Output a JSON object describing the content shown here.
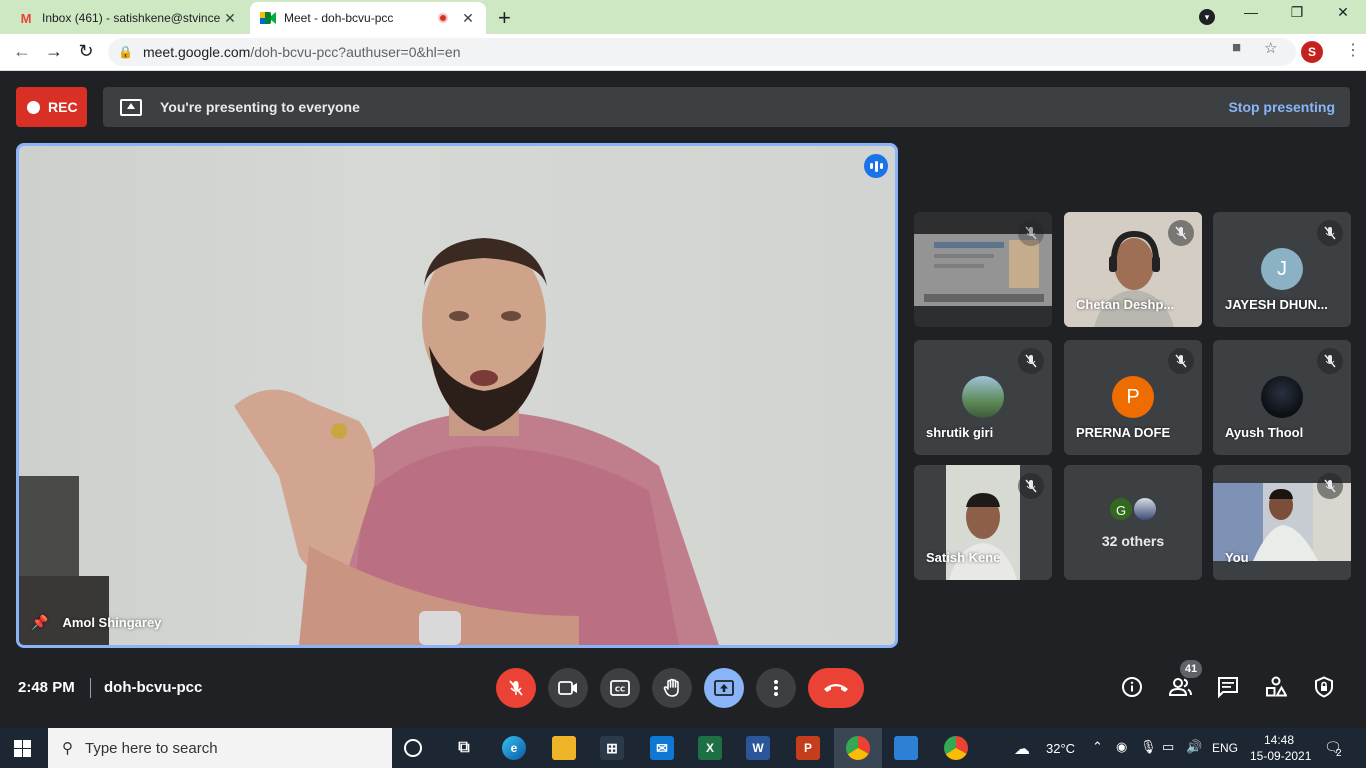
{
  "browser": {
    "tabs": [
      {
        "title": "Inbox (461) - satishkene@stvince",
        "favicon": "M",
        "active": false
      },
      {
        "title": "Meet - doh-bcvu-pcc",
        "favicon": "meet-icon",
        "active": true
      }
    ],
    "url_host": "meet.google.com",
    "url_path": "/doh-bcvu-pcc?authuser=0&hl=en",
    "profile_initial": "S"
  },
  "meet": {
    "rec_label": "REC",
    "presenting_text": "You're presenting to everyone",
    "stop_presenting": "Stop presenting",
    "main_speaker": "Amol Shingarey",
    "tiles": [
      {
        "name": "",
        "type": "screen"
      },
      {
        "name": "Chetan Deshp...",
        "type": "video"
      },
      {
        "name": "JAYESH DHUN...",
        "type": "avatar",
        "initial": "J",
        "color": "#8bb1c4"
      },
      {
        "name": "shrutik giri",
        "type": "photo"
      },
      {
        "name": "PRERNA DOFE",
        "type": "avatar",
        "initial": "P",
        "color": "#ef6c00"
      },
      {
        "name": "Ayush Thool",
        "type": "photo"
      },
      {
        "name": "Satish Kene",
        "type": "video"
      },
      {
        "name": "32 others",
        "type": "others",
        "initial": "G",
        "color": "#33691e"
      },
      {
        "name": "You",
        "type": "video"
      }
    ],
    "time": "2:48 PM",
    "meeting_code": "doh-bcvu-pcc",
    "participant_count": "41",
    "colors": {
      "accent": "#8ab4f8",
      "danger": "#ea4335",
      "surface": "#3c4043",
      "bg": "#202124"
    }
  },
  "taskbar": {
    "search_placeholder": "Type here to search",
    "weather": "32°C",
    "language": "ENG",
    "clock_time": "14:48",
    "clock_date": "15-09-2021",
    "notifications": "2"
  }
}
